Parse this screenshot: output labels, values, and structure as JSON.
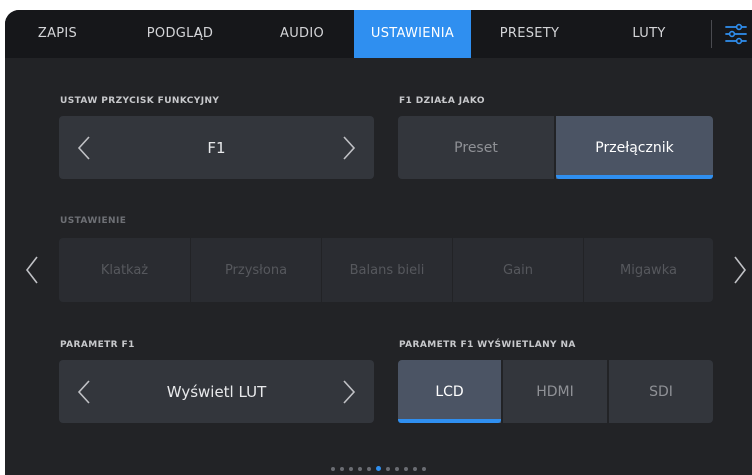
{
  "tabs": [
    {
      "label": "ZAPIS",
      "active": false
    },
    {
      "label": "PODGLĄD",
      "active": false
    },
    {
      "label": "AUDIO",
      "active": false
    },
    {
      "label": "USTAWIENIA",
      "active": true
    },
    {
      "label": "PRESETY",
      "active": false
    },
    {
      "label": "LUTY",
      "active": false
    }
  ],
  "function_button": {
    "label": "USTAW PRZYCISK FUNKCYJNY",
    "value": "F1"
  },
  "f1_mode": {
    "label": "F1 DZIAŁA JAKO",
    "options": [
      "Preset",
      "Przełącznik"
    ],
    "selected": "Przełącznik"
  },
  "setting": {
    "label": "USTAWIENIE",
    "options": [
      "Klatkaż",
      "Przysłona",
      "Balans bieli",
      "Gain",
      "Migawka"
    ]
  },
  "f1_param": {
    "label": "PARAMETR F1",
    "value": "Wyświetl LUT"
  },
  "f1_display": {
    "label": "PARAMETR F1 WYŚWIETLANY NA",
    "options": [
      "LCD",
      "HDMI",
      "SDI"
    ],
    "selected": "LCD"
  },
  "pagination": {
    "total": 11,
    "current": 5
  },
  "colors": {
    "accent": "#2f8ff0",
    "background": "#222326",
    "tabbar": "#16171a",
    "control": "#33363c"
  }
}
